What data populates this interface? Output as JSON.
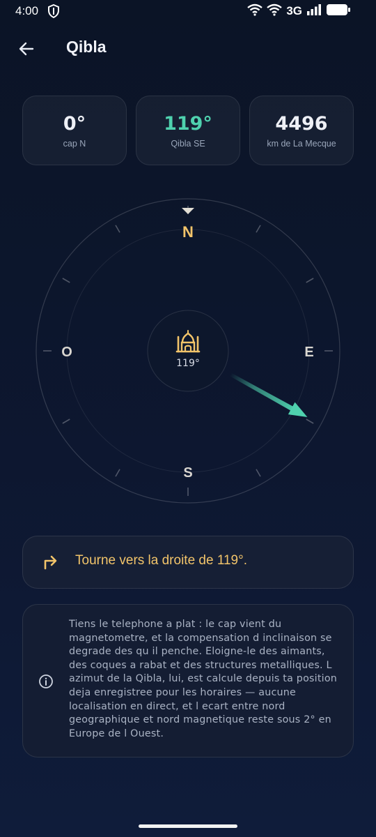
{
  "status": {
    "time": "4:00",
    "network": "3G",
    "icons": [
      "shield-icon",
      "wifi-icon",
      "wifi-icon",
      "signal-icon",
      "battery-icon"
    ]
  },
  "header": {
    "title": "Qibla",
    "back_icon": "arrow-left-icon"
  },
  "stats": [
    {
      "value": "0°",
      "label": "cap N",
      "color": "#eef0f6"
    },
    {
      "value": "119°",
      "label": "Qibla SE",
      "color": "#4fd1ae"
    },
    {
      "value": "4496",
      "label": "km de La Mecque",
      "color": "#eef0f6"
    }
  ],
  "compass": {
    "heading_deg": 0,
    "qibla_deg": 119,
    "cardinals": {
      "north": "N",
      "east": "E",
      "south": "S",
      "west": "O"
    },
    "center_label": "119°",
    "center_icon": "mosque-icon",
    "accent_gold": "#f2c46a",
    "accent_teal": "#4fd1ae"
  },
  "banner": {
    "icon": "turn-right-icon",
    "text": "Tourne vers la droite de 119°."
  },
  "info": {
    "icon": "info-icon",
    "text": "Tiens le telephone a plat : le cap vient du magnetometre, et la compensation d inclinaison se degrade des qu il penche. Eloigne-le des aimants, des coques a rabat et des structures metalliques. L azimut de la Qibla, lui, est calcule depuis ta position deja enregistree pour les horaires — aucune localisation en direct, et l ecart entre nord geographique et nord magnetique reste sous 2° en Europe de l Ouest."
  }
}
